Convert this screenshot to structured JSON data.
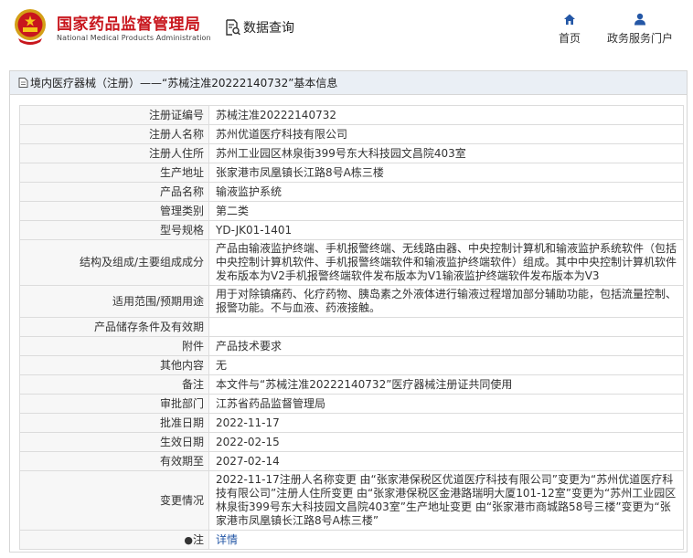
{
  "header": {
    "title_cn": "国家药品监督管理局",
    "title_en": "National Medical Products Administration",
    "data_query": "数据查询",
    "nav": [
      {
        "label": "首页",
        "icon": "home-icon"
      },
      {
        "label": "政务服务门户",
        "icon": "user-icon"
      }
    ]
  },
  "panel": {
    "title": "境内医疗器械（注册）——“苏械注准20222140732”基本信息"
  },
  "rows": [
    {
      "label": "注册证编号",
      "value": "苏械注准20222140732"
    },
    {
      "label": "注册人名称",
      "value": "苏州优道医疗科技有限公司"
    },
    {
      "label": "注册人住所",
      "value": "苏州工业园区林泉街399号东大科技园文昌院403室"
    },
    {
      "label": "生产地址",
      "value": "张家港市凤凰镇长江路8号A栋三楼"
    },
    {
      "label": "产品名称",
      "value": "输液监护系统"
    },
    {
      "label": "管理类别",
      "value": "第二类"
    },
    {
      "label": "型号规格",
      "value": "YD-JK01-1401"
    },
    {
      "label": "结构及组成/主要组成成分",
      "value": "产品由输液监护终端、手机报警终端、无线路由器、中央控制计算机和输液监护系统软件（包括中央控制计算机软件、手机报警终端软件和输液监护终端软件）组成。其中中央控制计算机软件发布版本为V2手机报警终端软件发布版本为V1输液监护终端软件发布版本为V3"
    },
    {
      "label": "适用范围/预期用途",
      "value": "用于对除镇痛药、化疗药物、胰岛素之外液体进行输液过程增加部分辅助功能，包括流量控制、报警功能。不与血液、药液接触。"
    },
    {
      "label": "产品储存条件及有效期",
      "value": ""
    },
    {
      "label": "附件",
      "value": "产品技术要求"
    },
    {
      "label": "其他内容",
      "value": "无"
    },
    {
      "label": "备注",
      "value": "本文件与“苏械注准20222140732”医疗器械注册证共同使用"
    },
    {
      "label": "审批部门",
      "value": "江苏省药品监督管理局"
    },
    {
      "label": "批准日期",
      "value": "2022-11-17"
    },
    {
      "label": "生效日期",
      "value": "2022-02-15"
    },
    {
      "label": "有效期至",
      "value": "2027-02-14"
    },
    {
      "label": "变更情况",
      "value": "2022-11-17注册人名称变更 由“张家港保税区优道医疗科技有限公司”变更为“苏州优道医疗科技有限公司”注册人住所变更 由“张家港保税区金港路瑞明大厦101-12室”变更为“苏州工业园区林泉街399号东大科技园文昌院403室”生产地址变更 由“张家港市商城路58号三楼”变更为“张家港市凤凰镇长江路8号A栋三楼”"
    },
    {
      "label": "注",
      "value": "详情"
    }
  ],
  "colors": {
    "brand_red": "#c8161d",
    "link_blue": "#2457a6",
    "panel_head_bg": "#eaeff5"
  }
}
